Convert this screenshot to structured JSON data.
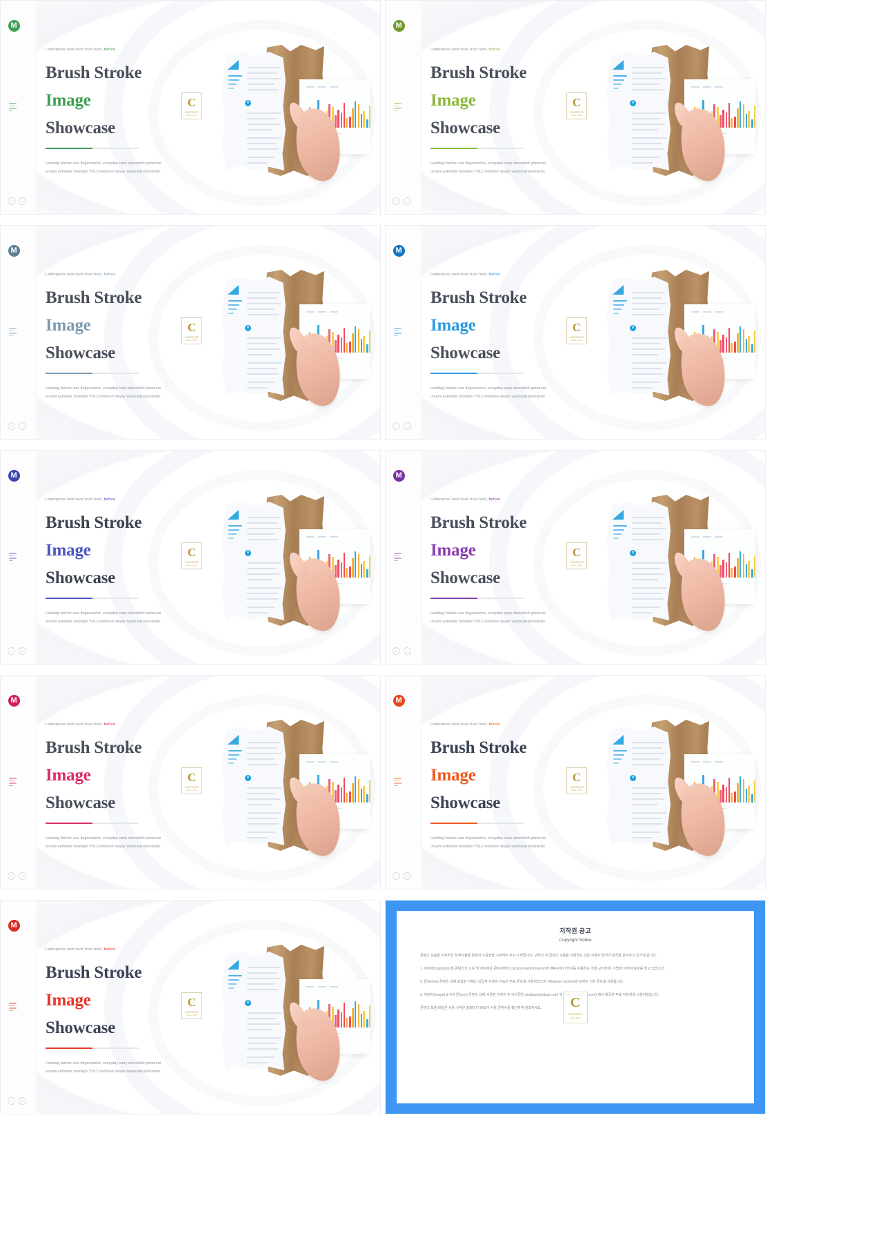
{
  "slide": {
    "eyebrow_prefix": "Letterpress next level trust fund,",
    "eyebrow_accent": "before.",
    "title_line1": "Brush Stroke",
    "title_line2": "Image",
    "title_line3": "Showcase",
    "desc_line1": "Hashtag fashion axe fingerstache, everyday carry shoreditch pinterest",
    "desc_line2": "umami authentic brooklyn YOLO heirloom keytar waistcoat kickstarter.",
    "badge_letter": "C",
    "badge_text1": "CONTENTS",
    "badge_text2": "MALL.COM",
    "chart_dot_label": "0",
    "nav_prev": "←",
    "nav_next": "→",
    "logo_letter": "M"
  },
  "slides": [
    {
      "id": 1,
      "accent": "#3f9e55",
      "logo": "#3f9e55",
      "title_color": "#4a4f5c"
    },
    {
      "id": 2,
      "accent": "#8cb83f",
      "logo": "#6f9a2c",
      "title_color": "#4a4f5c"
    },
    {
      "id": 3,
      "accent": "#7e9bb0",
      "logo": "#5d7d93",
      "title_color": "#4a4f5c"
    },
    {
      "id": 4,
      "accent": "#2f9ae0",
      "logo": "#1176c4",
      "title_color": "#4a4f5c"
    },
    {
      "id": 5,
      "accent": "#4b57bf",
      "logo": "#3b46ae",
      "title_color": "#3e4351"
    },
    {
      "id": 6,
      "accent": "#8a3fb0",
      "logo": "#7c2fa3",
      "title_color": "#4a4f5c"
    },
    {
      "id": 7,
      "accent": "#d92b6a",
      "logo": "#cf1f5e",
      "title_color": "#4a4f5c"
    },
    {
      "id": 8,
      "accent": "#ef5a1e",
      "logo": "#e4491a",
      "title_color": "#3b4456"
    },
    {
      "id": 9,
      "accent": "#e8362a",
      "logo": "#d62b20",
      "title_color": "#3b4456"
    }
  ],
  "copyright": {
    "heading_ko": "저작권 공고",
    "heading_en": "Copyright Notice",
    "intro": "콘텐츠 모음을 시작하신 천재사용을 환영하 소중한을 시버하여 주시기 바랍니다. 귀하신 이 콘텐츠 모음을 사용하는 것은 사용자 본커의 원칙을 준수하고 있기에 합니다.",
    "p1": "1. 저작권(copyright) 본 콘텐츠의 소유 및 저작권은 콘텐사바이고요요(contentcholeout)에 세탁시에서 한자를 사용하는 것을 근지하며, 기법에 의하여 보호를 받고 있습니다.",
    "p2": "2. 폰트(font) 콘텐츠 내에 포함된 서체는 상업적 사용이 가능한 무료 폰트를 사용하였으며, Windows System에 설치된 기본 폰트를 사용합니다.",
    "p3": "3. 이미지(image) & 아이콘(icon) 콘텐츠 내에 사용된 이미지 및 아이콘은 pixabay(pixabay.com) 및 pixabay(pixabay.com) 에서 제공한 무료 이미지를 사용하였습니다.",
    "outro": "콘텐츠 모음 파일은 사용 시작은 솔페이지 바로가 사용 콘텐사를 확인하여 참조하세요.",
    "badge_letter": "C",
    "badge_text1": "CONTENTS",
    "badge_text2": "MALL.COM"
  }
}
